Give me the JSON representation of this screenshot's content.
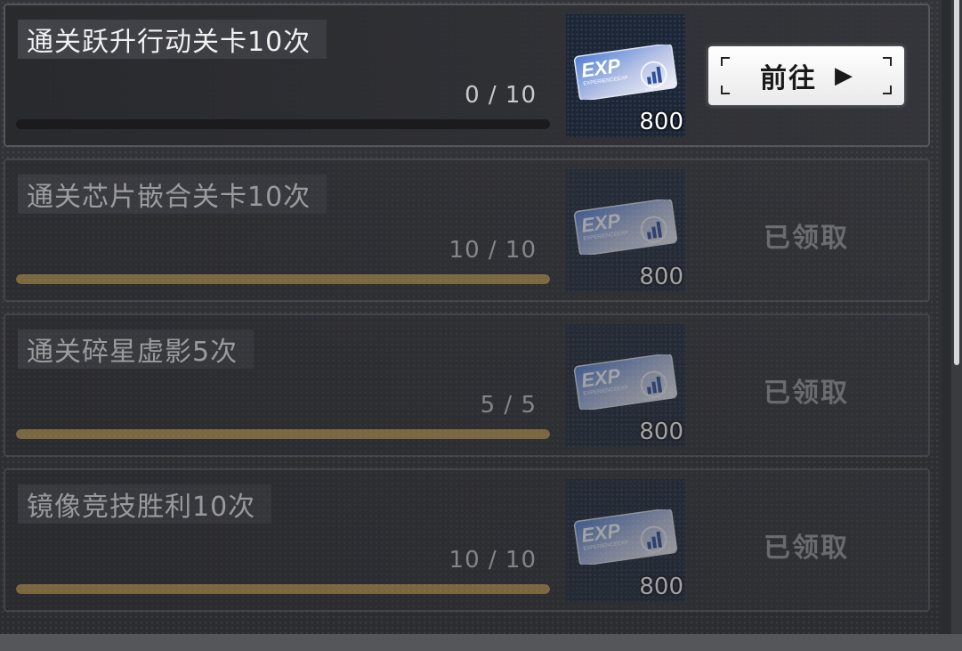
{
  "tasks": [
    {
      "title": "通关跃升行动关卡10次",
      "progress": "0 / 10",
      "fraction": 0.0,
      "reward_count": "800",
      "action": "前往",
      "status": "pending"
    },
    {
      "title": "通关芯片嵌合关卡10次",
      "progress": "10 / 10",
      "fraction": 1.0,
      "reward_count": "800",
      "action": "已领取",
      "status": "claimed"
    },
    {
      "title": "通关碎星虚影5次",
      "progress": "5 / 5",
      "fraction": 1.0,
      "reward_count": "800",
      "action": "已领取",
      "status": "claimed"
    },
    {
      "title": "镜像竞技胜利10次",
      "progress": "10 / 10",
      "fraction": 1.0,
      "reward_count": "800",
      "action": "已领取",
      "status": "claimed"
    }
  ],
  "reward_card": {
    "text": "EXP",
    "subtext": "EXPERIENCEEXP"
  },
  "colors": {
    "bar_fill": "#b9974e",
    "bar_track": "#1b1b1e",
    "button_bg": "#ffffff"
  },
  "icons": {
    "go_arrow": "play-triangle-icon",
    "reward": "exp-card-icon"
  }
}
